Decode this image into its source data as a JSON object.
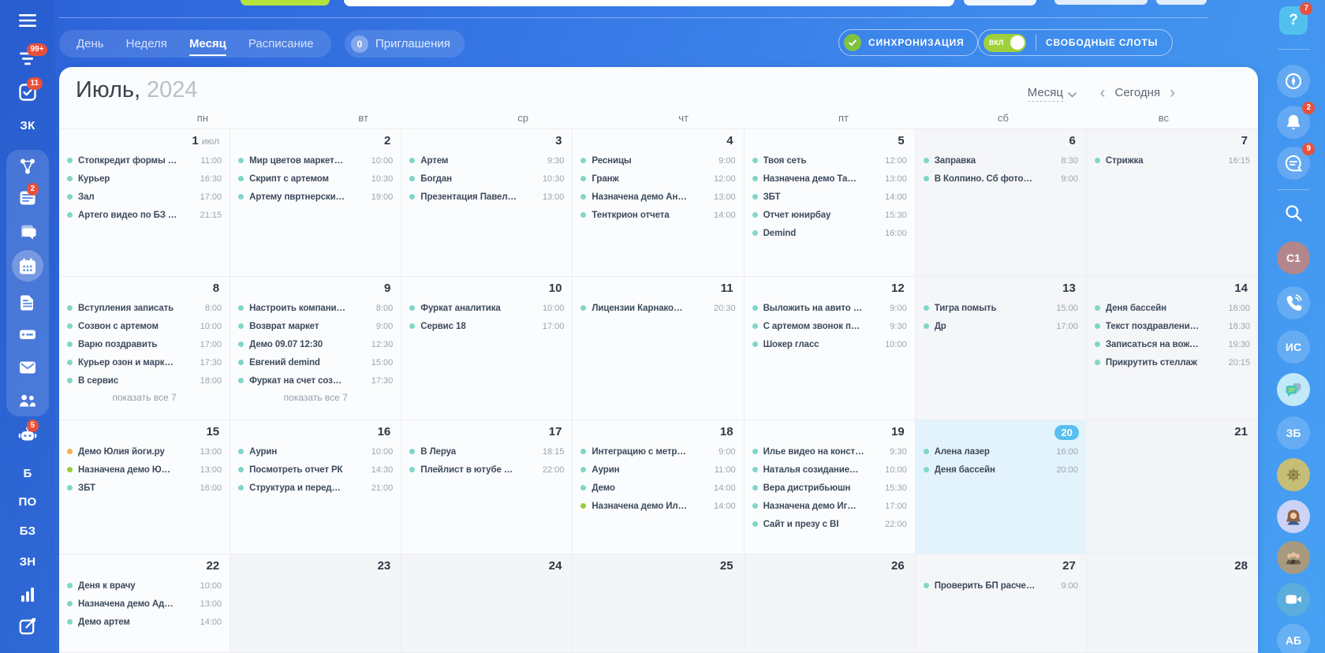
{
  "topbar": {
    "tabs": [
      {
        "label": "День",
        "active": false
      },
      {
        "label": "Неделя",
        "active": false
      },
      {
        "label": "Месяц",
        "active": true
      },
      {
        "label": "Расписание",
        "active": false
      }
    ],
    "invitations": {
      "count": "0",
      "label": "Приглашения"
    },
    "sync_label": "СИНХРОНИЗАЦИЯ",
    "toggle_label": "ВКЛ",
    "free_slots_label": "СВОБОДНЫЕ СЛОТЫ"
  },
  "left_sidebar": {
    "top_items": [
      {
        "icon": "menu"
      },
      {
        "icon": "feed",
        "badge": "99+"
      },
      {
        "icon": "tasks",
        "badge": "11"
      },
      {
        "text": "ЗК"
      }
    ],
    "panel_items": [
      {
        "icon": "share"
      },
      {
        "icon": "news",
        "badge": "2"
      },
      {
        "icon": "messenger"
      },
      {
        "icon": "calendar",
        "active": true
      },
      {
        "icon": "documents"
      },
      {
        "icon": "drive"
      },
      {
        "icon": "mail"
      },
      {
        "icon": "people"
      }
    ],
    "bottom_items": [
      {
        "icon": "bot",
        "badge": "5"
      },
      {
        "text": "Б"
      },
      {
        "text": "ПО"
      },
      {
        "text": "БЗ"
      },
      {
        "text": "ЗН"
      },
      {
        "icon": "chart"
      },
      {
        "icon": "compose"
      }
    ]
  },
  "right_sidebar": {
    "items": [
      {
        "type": "help",
        "glyph": "?",
        "badge": "7"
      },
      {
        "type": "divider"
      },
      {
        "type": "icon",
        "icon": "compass"
      },
      {
        "type": "icon",
        "icon": "bell",
        "badge": "2"
      },
      {
        "type": "icon",
        "icon": "chatlines",
        "badge": "9"
      },
      {
        "type": "divider"
      },
      {
        "type": "icon",
        "icon": "search",
        "bare": true
      },
      {
        "type": "avatar",
        "text": "C1",
        "color": "#b2868c"
      },
      {
        "type": "icon",
        "icon": "phone"
      },
      {
        "type": "avatar",
        "text": "ИС"
      },
      {
        "type": "icon",
        "icon": "chatteal",
        "bg": "#c2e9f7"
      },
      {
        "type": "avatar",
        "text": "ЗБ"
      },
      {
        "type": "img",
        "icon": "crest"
      },
      {
        "type": "img",
        "icon": "woman"
      },
      {
        "type": "img",
        "icon": "group"
      },
      {
        "type": "icon",
        "icon": "video",
        "bg": "rgba(110,185,200,.55)"
      },
      {
        "type": "avatar",
        "text": "АБ"
      }
    ]
  },
  "calendar": {
    "title_month": "Июль,",
    "title_year": "2024",
    "view_label": "Месяц",
    "today_label": "Сегодня",
    "nav_prev": "‹",
    "nav_next": "›",
    "weekdays": [
      "пн",
      "вт",
      "ср",
      "чт",
      "пт",
      "сб",
      "вс"
    ],
    "weeks": [
      [
        {
          "num": "1",
          "suffix": "июл",
          "events": [
            {
              "dot": "teal",
              "title": "Стопкредит формы …",
              "time": "11:00"
            },
            {
              "dot": "teal",
              "title": "Курьер",
              "time": "16:30"
            },
            {
              "dot": "teal",
              "title": "Зал",
              "time": "17:00"
            },
            {
              "dot": "teal",
              "title": "Артего видео по БЗ …",
              "time": "21:15"
            }
          ]
        },
        {
          "num": "2",
          "events": [
            {
              "dot": "teal",
              "title": "Мир цветов маркет…",
              "time": "10:00"
            },
            {
              "dot": "teal",
              "title": "Скрипт с артемом",
              "time": "10:30"
            },
            {
              "dot": "teal",
              "title": "Артему пвртнерски…",
              "time": "19:00"
            }
          ]
        },
        {
          "num": "3",
          "events": [
            {
              "dot": "teal",
              "title": "Артем",
              "time": "9:30"
            },
            {
              "dot": "teal",
              "title": "Богдан",
              "time": "10:30"
            },
            {
              "dot": "teal",
              "title": "Презентация Павел…",
              "time": "13:00"
            }
          ]
        },
        {
          "num": "4",
          "events": [
            {
              "dot": "teal",
              "title": "Ресницы",
              "time": "9:00"
            },
            {
              "dot": "teal",
              "title": "Гранж",
              "time": "12:00"
            },
            {
              "dot": "teal",
              "title": "Назначена демо Ан…",
              "time": "13:00"
            },
            {
              "dot": "teal",
              "title": "Тенткрион отчета",
              "time": "14:00"
            }
          ]
        },
        {
          "num": "5",
          "events": [
            {
              "dot": "teal",
              "title": "Твоя сеть",
              "time": "12:00"
            },
            {
              "dot": "teal",
              "title": "Назначена демо Та…",
              "time": "13:00"
            },
            {
              "dot": "teal",
              "title": "ЗБТ",
              "time": "14:00"
            },
            {
              "dot": "teal",
              "title": "Отчет юнирбау",
              "time": "15:30"
            },
            {
              "dot": "teal",
              "title": "Demind",
              "time": "16:00"
            }
          ]
        },
        {
          "num": "6",
          "events": [
            {
              "dot": "teal",
              "title": "Заправка",
              "time": "8:30"
            },
            {
              "dot": "teal",
              "title": "В Колпино. Сб фото…",
              "time": "9:00"
            }
          ]
        },
        {
          "num": "7",
          "events": [
            {
              "dot": "teal",
              "title": "Стрижка",
              "time": "16:15"
            }
          ]
        }
      ],
      [
        {
          "num": "8",
          "more": "показать все 7",
          "events": [
            {
              "dot": "teal",
              "title": "Вступления записать",
              "time": "8:00"
            },
            {
              "dot": "teal",
              "title": "Созвон с артемом",
              "time": "10:00"
            },
            {
              "dot": "teal",
              "title": "Варю поздравить",
              "time": "17:00"
            },
            {
              "dot": "teal",
              "title": "Курьер озон и марк…",
              "time": "17:30"
            },
            {
              "dot": "teal",
              "title": "В сервис",
              "time": "18:00"
            }
          ]
        },
        {
          "num": "9",
          "more": "показать все 7",
          "events": [
            {
              "dot": "teal",
              "title": "Настроить компани…",
              "time": "8:00"
            },
            {
              "dot": "teal",
              "title": "Возврат маркет",
              "time": "9:00"
            },
            {
              "dot": "teal",
              "title": "Демо 09.07 12:30",
              "time": "12:30"
            },
            {
              "dot": "teal",
              "title": "Евгений demind",
              "time": "15:00"
            },
            {
              "dot": "teal",
              "title": "Фуркат на счет соз…",
              "time": "17:30"
            }
          ]
        },
        {
          "num": "10",
          "events": [
            {
              "dot": "teal",
              "title": "Фуркат аналитика",
              "time": "10:00"
            },
            {
              "dot": "teal",
              "title": "Сервис 18",
              "time": "17:00"
            }
          ]
        },
        {
          "num": "11",
          "events": [
            {
              "dot": "teal",
              "title": "Лицензии Карнако…",
              "time": "20:30"
            }
          ]
        },
        {
          "num": "12",
          "events": [
            {
              "dot": "teal",
              "title": "Выложить на авито …",
              "time": "9:00"
            },
            {
              "dot": "teal",
              "title": "С артемом звонок п…",
              "time": "9:30"
            },
            {
              "dot": "teal",
              "title": "Шокер гласс",
              "time": "10:00"
            }
          ]
        },
        {
          "num": "13",
          "events": [
            {
              "dot": "teal",
              "title": "Тигра помыть",
              "time": "15:00"
            },
            {
              "dot": "teal",
              "title": "Др",
              "time": "17:00"
            }
          ]
        },
        {
          "num": "14",
          "events": [
            {
              "dot": "teal",
              "title": "Деня бассейн",
              "time": "16:00"
            },
            {
              "dot": "teal",
              "title": "Текст поздравлени…",
              "time": "18:30"
            },
            {
              "dot": "teal",
              "title": "Записаться на вож…",
              "time": "19:30"
            },
            {
              "dot": "teal",
              "title": "Прикрутить стеллаж",
              "time": "20:15"
            }
          ]
        }
      ],
      [
        {
          "num": "15",
          "events": [
            {
              "dot": "orange",
              "title": "Демо Юлия йоги.ру",
              "time": "13:00"
            },
            {
              "dot": "green",
              "title": "Назначена демо Ю…",
              "time": "13:00"
            },
            {
              "dot": "teal",
              "title": "ЗБТ",
              "time": "16:00"
            }
          ]
        },
        {
          "num": "16",
          "events": [
            {
              "dot": "teal",
              "title": "Аурин",
              "time": "10:00"
            },
            {
              "dot": "teal",
              "title": "Посмотреть отчет РК",
              "time": "14:30"
            },
            {
              "dot": "teal",
              "title": "Структура и перед…",
              "time": "21:00"
            }
          ]
        },
        {
          "num": "17",
          "events": [
            {
              "dot": "teal",
              "title": "В Леруа",
              "time": "18:15"
            },
            {
              "dot": "teal",
              "title": "Плейлист в ютубе …",
              "time": "22:00"
            }
          ]
        },
        {
          "num": "18",
          "events": [
            {
              "dot": "teal",
              "title": "Интеграцию с метр…",
              "time": "9:00"
            },
            {
              "dot": "teal",
              "title": "Аурин",
              "time": "11:00"
            },
            {
              "dot": "teal",
              "title": "Демо",
              "time": "14:00"
            },
            {
              "dot": "green",
              "title": "Назначена демо Ил…",
              "time": "14:00"
            }
          ]
        },
        {
          "num": "19",
          "events": [
            {
              "dot": "teal",
              "title": "Илье видео на конст…",
              "time": "9:30"
            },
            {
              "dot": "teal",
              "title": "Наталья созидание…",
              "time": "10:00"
            },
            {
              "dot": "teal",
              "title": "Вера дистрибьюшн",
              "time": "15:30"
            },
            {
              "dot": "teal",
              "title": "Назначена демо Иг…",
              "time": "17:00"
            },
            {
              "dot": "teal",
              "title": "Сайт и презу с BI",
              "time": "22:00"
            }
          ]
        },
        {
          "num": "20",
          "today": true,
          "events": [
            {
              "dot": "teal",
              "title": "Алена лазер",
              "time": "16:00"
            },
            {
              "dot": "teal",
              "title": "Деня бассейн",
              "time": "20:00"
            }
          ]
        },
        {
          "num": "21",
          "events": []
        }
      ],
      [
        {
          "num": "22",
          "events": [
            {
              "dot": "teal",
              "title": "Деня к врачу",
              "time": "10:00"
            },
            {
              "dot": "teal",
              "title": "Назначена демо Ад…",
              "time": "13:00"
            },
            {
              "dot": "teal",
              "title": "Демо артем",
              "time": "14:00"
            }
          ]
        },
        {
          "num": "23",
          "events": []
        },
        {
          "num": "24",
          "events": []
        },
        {
          "num": "25",
          "events": []
        },
        {
          "num": "26",
          "events": []
        },
        {
          "num": "27",
          "events": [
            {
              "dot": "teal",
              "title": "Проверить БП расче…",
              "time": "9:00"
            }
          ]
        },
        {
          "num": "28",
          "events": []
        }
      ]
    ]
  },
  "colors": {
    "teal": "#7fd7c7",
    "green": "#9ccb3c",
    "orange": "#f2b04e",
    "today_badge": "#58bfee",
    "notification_badge": "#e8503c",
    "accent_green": "#9fd03b"
  }
}
